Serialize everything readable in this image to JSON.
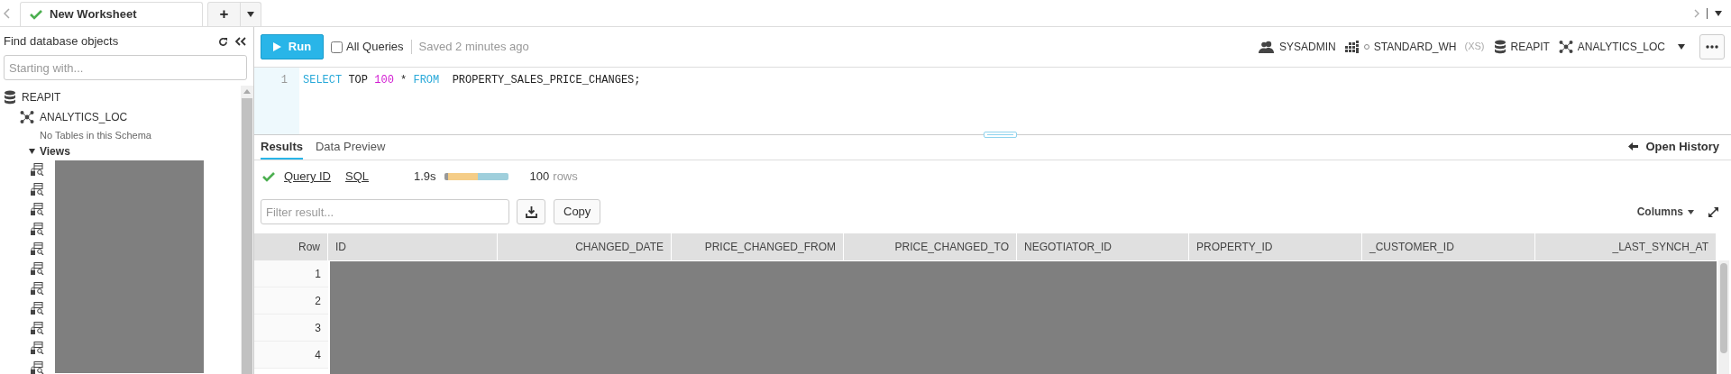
{
  "tab_bar": {
    "tabs": [
      {
        "label": "New Worksheet",
        "selected": true
      }
    ],
    "add_label": "+"
  },
  "sidebar": {
    "title": "Find database objects",
    "search": {
      "placeholder": "Starting with..."
    },
    "tree": [
      {
        "label": "REAPIT",
        "kind": "database",
        "children": [
          {
            "label": "ANALYTICS_LOC",
            "kind": "schema",
            "children": [
              {
                "label": "No Tables in this Schema",
                "kind": "note"
              },
              {
                "label": "Views",
                "kind": "folder",
                "expanded": true,
                "children": [
                  {
                    "kind": "view"
                  },
                  {
                    "kind": "view"
                  },
                  {
                    "kind": "view"
                  },
                  {
                    "kind": "view"
                  },
                  {
                    "kind": "view"
                  },
                  {
                    "kind": "view"
                  },
                  {
                    "kind": "view"
                  },
                  {
                    "kind": "view"
                  },
                  {
                    "kind": "view"
                  },
                  {
                    "kind": "view"
                  },
                  {
                    "kind": "view"
                  }
                ]
              }
            ]
          }
        ]
      }
    ]
  },
  "toolbar": {
    "run_label": "Run",
    "all_queries": {
      "label": "All Queries",
      "checked": false
    },
    "saved": "Saved 2 minutes ago",
    "context": [
      {
        "kind": "role",
        "label": "SYSADMIN"
      },
      {
        "kind": "warehouse",
        "label": "STANDARD_WH",
        "size": "(XS)"
      },
      {
        "kind": "database",
        "label": "REAPIT"
      },
      {
        "kind": "schema",
        "label": "ANALYTICS_LOC"
      }
    ]
  },
  "editor": {
    "lines": [
      {
        "number": "1",
        "tokens": [
          {
            "kind": "keyword",
            "text": "SELECT"
          },
          {
            "kind": "plain",
            "text": " TOP "
          },
          {
            "kind": "number",
            "text": "100"
          },
          {
            "kind": "plain",
            "text": " * "
          },
          {
            "kind": "keyword",
            "text": "FROM"
          },
          {
            "kind": "plain",
            "text": "  PROPERTY_SALES_PRICE_CHANGES;"
          }
        ]
      }
    ]
  },
  "results": {
    "tabs": [
      {
        "label": "Results",
        "selected": true
      },
      {
        "label": "Data Preview",
        "selected": false
      }
    ],
    "open_history": "Open History",
    "query": {
      "query_id": "Query ID",
      "sql": "SQL",
      "duration": "1.9s",
      "row_count": "100",
      "row_unit": "rows"
    },
    "filter": {
      "placeholder": "Filter result..."
    },
    "copy_label": "Copy",
    "columns_label": "Columns",
    "table": {
      "columns": [
        {
          "label": "Row",
          "right_aligned": true
        },
        {
          "label": "ID",
          "right_aligned": false
        },
        {
          "label": "CHANGED_DATE",
          "right_aligned": true
        },
        {
          "label": "PRICE_CHANGED_FROM",
          "right_aligned": true
        },
        {
          "label": "PRICE_CHANGED_TO",
          "right_aligned": true
        },
        {
          "label": "NEGOTIATOR_ID",
          "right_aligned": false
        },
        {
          "label": "PROPERTY_ID",
          "right_aligned": false
        },
        {
          "label": "_CUSTOMER_ID",
          "right_aligned": false
        },
        {
          "label": "_LAST_SYNCH_AT",
          "right_aligned": true
        }
      ],
      "rows": [
        {
          "number": "1"
        },
        {
          "number": "2"
        },
        {
          "number": "3"
        },
        {
          "number": "4"
        }
      ]
    }
  }
}
